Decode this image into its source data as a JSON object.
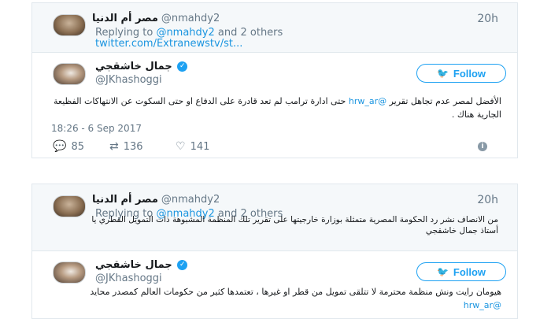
{
  "tweets": [
    {
      "reply_context": {
        "display_name": "مصر أم الدنيا",
        "handle": "@nmahdy2",
        "time": "20h",
        "replying_prefix": "Replying to ",
        "replying_handle": "@nmahdy2",
        "replying_suffix": " and 2 others",
        "link": "twitter.com/Extranewstv/st..."
      },
      "author": {
        "display_name": "جمال خاشقجي",
        "handle": "@JKhashoggi"
      },
      "follow_label": "Follow",
      "text_before_mention": "الأفضل لمصر عدم تجاهل تقرير ",
      "mention": "@hrw_ar",
      "text_after_mention": " حتى ادارة ترامب لم تعد قادرة على الدفاع او حتى السكوت عن الانتهاكات الفظيعة الجارية هناك .",
      "date": "18:26 - 6 Sep 2017",
      "actions": {
        "replies": "85",
        "retweets": "136",
        "likes": "141"
      }
    },
    {
      "reply_context": {
        "display_name": "مصر أم الدنيا",
        "handle": "@nmahdy2",
        "time": "20h",
        "replying_prefix": "Replying to ",
        "replying_handle": "@nmahdy2",
        "replying_suffix": " and 2 others",
        "text": "من الانصاف نشر رد الحكومة المصرية متمثلة بوزارة خارجيتها على تقرير تلك المنظمة المشبوهة ذات التمويل القطري يا أستاذ جمال خاشقجي"
      },
      "author": {
        "display_name": "جمال خاشقجي",
        "handle": "@JKhashoggi"
      },
      "follow_label": "Follow",
      "text": "هيومان رايت ونش منظمة محترمة لا تتلقى تمويل من قطر او غيرها ، تعتمدها كثير من حكومات العالم كمصدر محايد ",
      "mention": "@hrw_ar"
    }
  ],
  "icons": {
    "reply": "speech-bubble",
    "retweet": "retweet-arrows",
    "like": "heart-outline",
    "info": "info-circle",
    "verified": "check-badge",
    "follow": "twitter-bird"
  },
  "colors": {
    "accent": "#1da1f2",
    "link": "#1b95e0",
    "muted": "#657786",
    "border": "#e1e8ed"
  }
}
